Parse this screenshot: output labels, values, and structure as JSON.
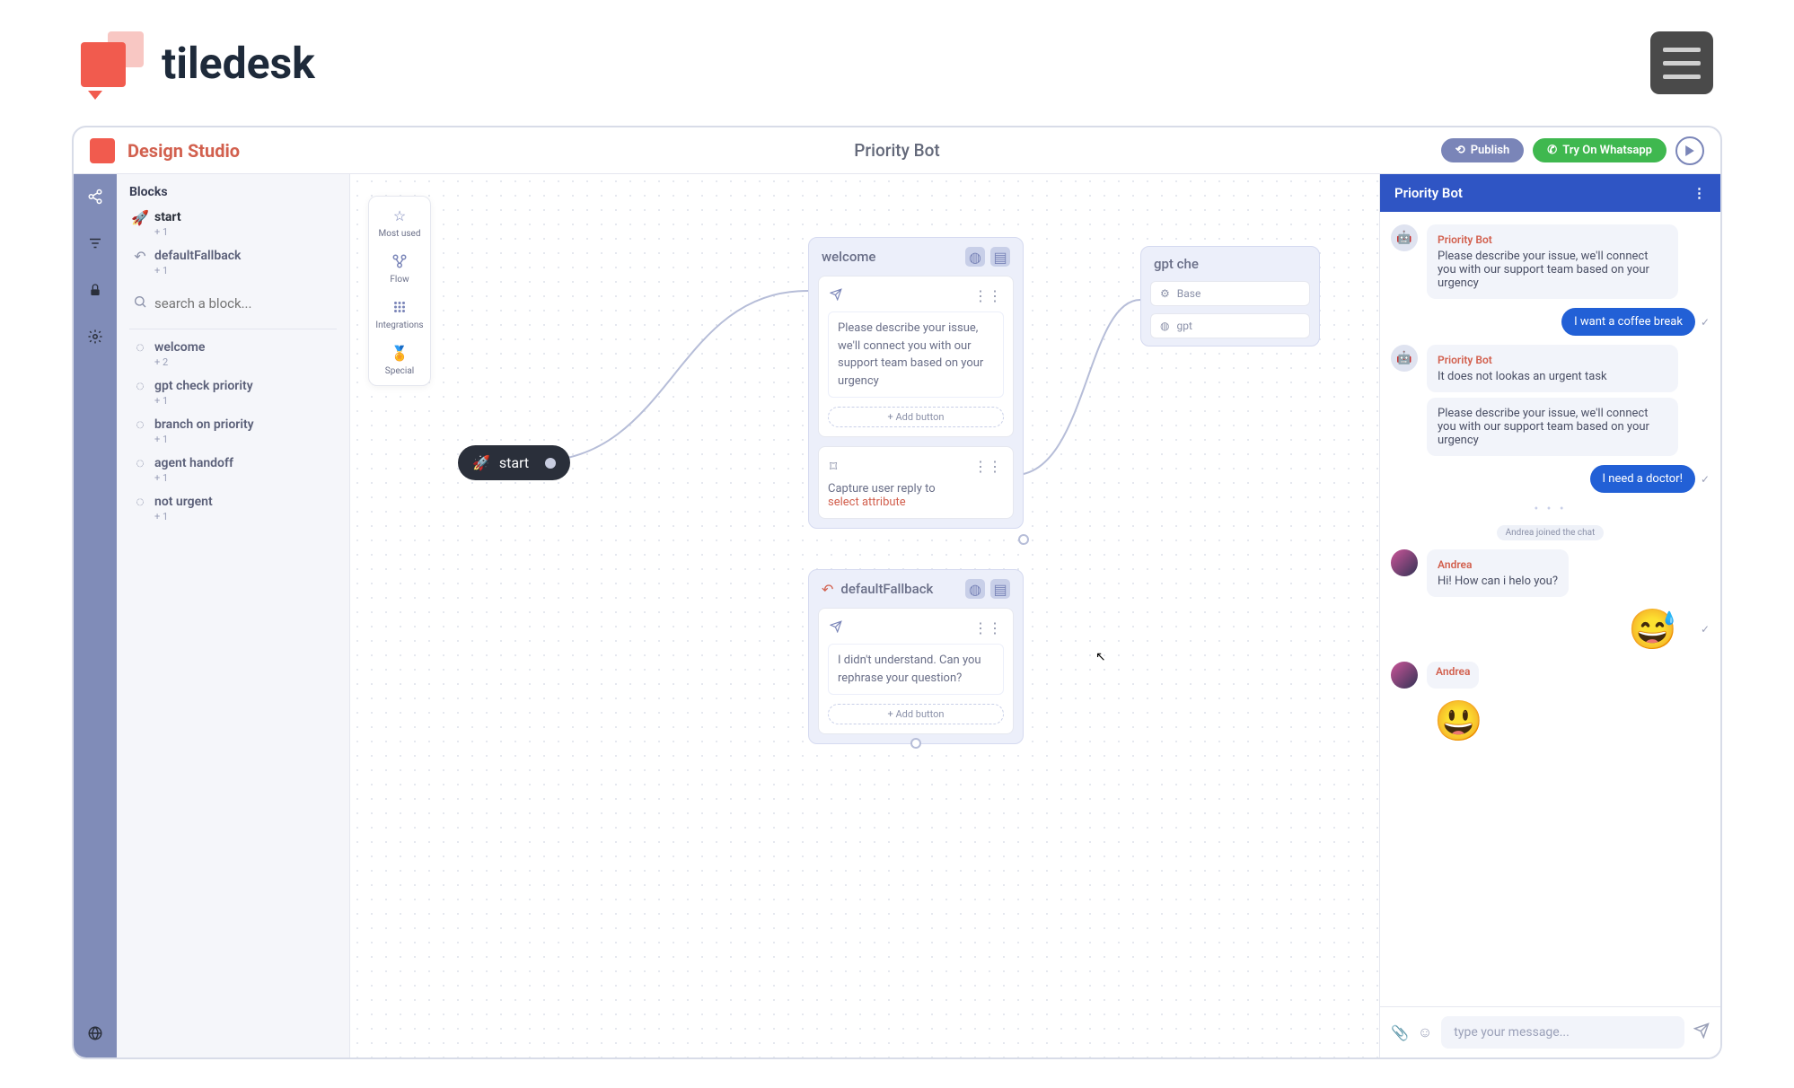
{
  "brand": {
    "name": "tiledesk"
  },
  "studio": {
    "title": "Design Studio",
    "bot_name": "Priority Bot",
    "publish_label": "Publish",
    "whatsapp_label": "Try On Whatsapp"
  },
  "blocks_panel": {
    "title": "Blocks",
    "search_placeholder": "search a block...",
    "top": [
      {
        "name": "start",
        "sub": "+ 1",
        "icon": "rocket"
      },
      {
        "name": "defaultFallback",
        "sub": "+ 1",
        "icon": "undo"
      }
    ],
    "items": [
      {
        "name": "welcome",
        "sub": "+ 2"
      },
      {
        "name": "gpt check priority",
        "sub": "+ 1"
      },
      {
        "name": "branch on priority",
        "sub": "+ 1"
      },
      {
        "name": "agent handoff",
        "sub": "+ 1"
      },
      {
        "name": "not urgent",
        "sub": "+ 1"
      }
    ]
  },
  "toolbox": [
    {
      "label": "Most used",
      "icon": "star"
    },
    {
      "label": "Flow",
      "icon": "flow"
    },
    {
      "label": "Integrations",
      "icon": "grid"
    },
    {
      "label": "Special",
      "icon": "medal"
    }
  ],
  "nodes": {
    "start": {
      "label": "start"
    },
    "welcome": {
      "title": "welcome",
      "message": "Please describe your issue, we'll connect you with our support team based on your urgency",
      "add_button": "+ Add button",
      "capture_prefix": "Capture user reply to",
      "capture_attr": "select attribute"
    },
    "fallback": {
      "title": "defaultFallback",
      "message": "I didn't understand. Can you rephrase your question?",
      "add_button": "+ Add button"
    },
    "gpt": {
      "title": "gpt che",
      "rows": [
        "Base",
        "gpt"
      ]
    }
  },
  "chat": {
    "header": "Priority Bot",
    "bot_name": "Priority Bot",
    "agent_name": "Andrea",
    "msg_describe": "Please describe your issue, we'll connect you with our support team based on your urgency",
    "user1": "I want a coffee break",
    "not_urgent": "It does not lookas an urgent task",
    "msg_describe2": "Please describe your issue, we'll connect you with our support team based on your urgency",
    "user2": "I need a doctor!",
    "system": "Andrea joined the chat",
    "agent_msg": "Hi! How can i helo you?",
    "input_placeholder": "type your message..."
  }
}
